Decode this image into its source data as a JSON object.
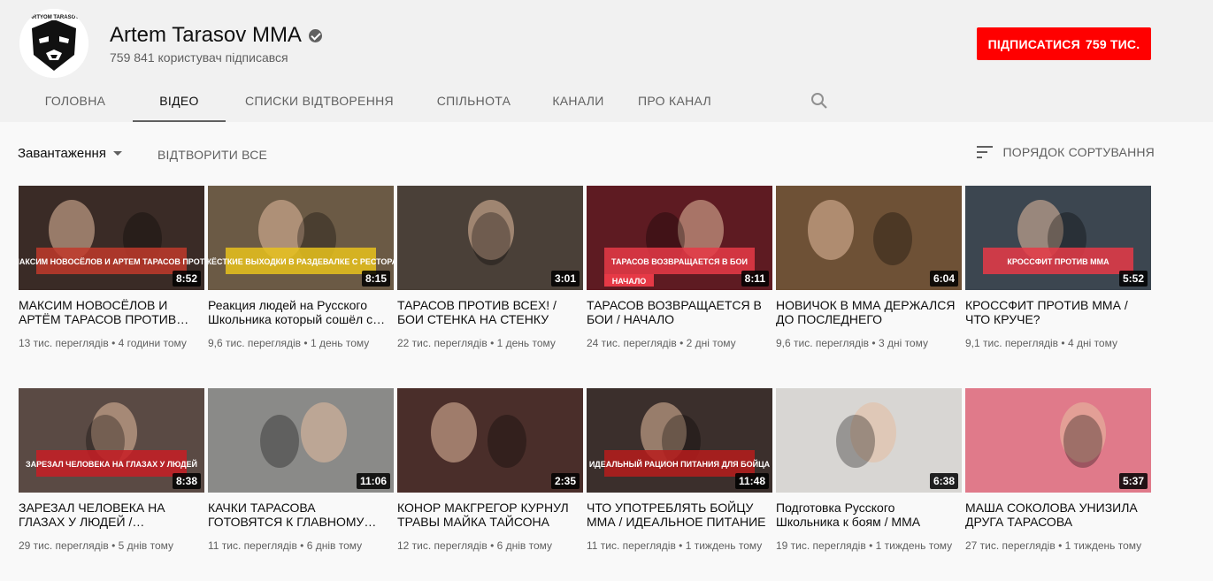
{
  "channel": {
    "name": "Artem Tarasov MMA",
    "subscribers": "759 841 користувач підписався",
    "logo_text": "ARTYOM TARASOV",
    "subscribe_label": "ПІДПИСАТИСЯ",
    "subscribe_count": "759 ТИС."
  },
  "tabs": [
    {
      "label": "ГОЛОВНА",
      "active": false
    },
    {
      "label": "ВІДЕО",
      "active": true
    },
    {
      "label": "СПИСКИ ВІДТВОРЕННЯ",
      "active": false
    },
    {
      "label": "СПІЛЬНОТА",
      "active": false
    },
    {
      "label": "КАНАЛИ",
      "active": false
    },
    {
      "label": "ПРО КАНАЛ",
      "active": false
    }
  ],
  "controls": {
    "uploads_label": "Завантаження",
    "play_all_label": "ВІДТВОРИТИ ВСЕ",
    "sort_label": "ПОРЯДОК СОРТУВАННЯ"
  },
  "colors": {
    "accent": "#ff0000",
    "text_secondary": "#606060",
    "header_bg": "#f1f1f1",
    "page_bg": "#f9f9f9"
  },
  "videos": [
    {
      "title": "МАКСИМ НОВОСЁЛОВ И АРТЁМ ТАРАСОВ ПРОТИВ ТРОИХ ПИТБУЛЕЙ",
      "views": "13 тис. переглядів",
      "age": "4 години тому",
      "duration": "8:52",
      "thumb_text": "МАКСИМ НОВОСЁЛОВ И АРТЕМ ТАРАСОВ ПРОТИВ ТРОИХ ПИТБУЛЕЙ",
      "bg": "#3a2b26",
      "accent": "#c0392b"
    },
    {
      "title": "Реакция людей на Русского Школьника который сошёл с ума",
      "views": "9,6 тис. переглядів",
      "age": "1 день тому",
      "duration": "8:15",
      "thumb_text": "ЖЁСТКИЕ ВЫХОДКИ В РАЗДЕВАЛКЕ С РЕСТОРАТОРОМ",
      "bg": "#6b5a45",
      "accent": "#e8c21c"
    },
    {
      "title": "ТАРАСОВ ПРОТИВ ВСЕХ! / БОИ СТЕНКА НА СТЕНКУ",
      "views": "22 тис. переглядів",
      "age": "1 день тому",
      "duration": "3:01",
      "thumb_text": "",
      "bg": "#4a4038",
      "accent": "#d62828"
    },
    {
      "title": "ТАРАСОВ ВОЗВРАЩАЕТСЯ В БОИ / НАЧАЛО",
      "views": "24 тис. переглядів",
      "age": "2 дні тому",
      "duration": "8:11",
      "thumb_text": "ТАРАСОВ ВОЗВРАЩАЕТСЯ В БОИ",
      "thumb_badge": "НАЧАЛО",
      "bg": "#5e1b22",
      "accent": "#e63946"
    },
    {
      "title": "НОВИЧОК В ММА ДЕРЖАЛСЯ ДО ПОСЛЕДНЕГО",
      "views": "9,6 тис. переглядів",
      "age": "3 дні тому",
      "duration": "6:04",
      "thumb_text": "",
      "bg": "#6e5136",
      "accent": "#b8432c"
    },
    {
      "title": "КРОССФИТ ПРОТИВ ММА / ЧТО КРУЧЕ?",
      "views": "9,1 тис. переглядів",
      "age": "4 дні тому",
      "duration": "5:52",
      "thumb_text": "КРОССФИТ ПРОТИВ ММА",
      "bg": "#3c4650",
      "accent": "#e63946"
    },
    {
      "title": "ЗАРЕЗАЛ ЧЕЛОВЕКА НА ГЛАЗАХ У ЛЮДЕЙ / СОЦИАЛЬНЫЙ ЭКСПЕРИМЕНТ",
      "views": "29 тис. переглядів",
      "age": "5 днів тому",
      "duration": "8:38",
      "thumb_text": "ЗАРЕЗАЛ ЧЕЛОВЕКА НА ГЛАЗАХ У ЛЮДЕЙ",
      "bg": "#5a4a44",
      "accent": "#c81d25"
    },
    {
      "title": "КАЧКИ ТАРАСОВА ГОТОВЯТСЯ К ГЛАВНОМУ ТУРНИРУ",
      "views": "11 тис. переглядів",
      "age": "6 днів тому",
      "duration": "11:06",
      "thumb_text": "",
      "bg": "#8a8a88",
      "accent": "#c62828"
    },
    {
      "title": "КОНОР МАКГРЕГОР КУРНУЛ ТРАВЫ МАЙКА ТАЙСОНА",
      "views": "12 тис. переглядів",
      "age": "6 днів тому",
      "duration": "2:35",
      "thumb_text": "",
      "bg": "#4a2e2a",
      "accent": "#e53935"
    },
    {
      "title": "ЧТО УПОТРЕБЛЯТЬ БОЙЦУ ММА / ИДЕАЛЬНОЕ ПИТАНИЕ",
      "views": "11 тис. переглядів",
      "age": "1 тиждень тому",
      "duration": "11:48",
      "thumb_text": "ИДЕАЛЬНЫЙ РАЦИОН ПИТАНИЯ ДЛЯ БОЙЦА",
      "bg": "#3b2f2c",
      "accent": "#b71c1c"
    },
    {
      "title": "Подготовка Русского Школьника к боям / ММА",
      "views": "19 тис. переглядів",
      "age": "1 тиждень тому",
      "duration": "6:38",
      "thumb_text": "",
      "bg": "#d8d6d3",
      "accent": "#222222"
    },
    {
      "title": "МАША СОКОЛОВА УНИЗИЛА ДРУГА ТАРАСОВА",
      "views": "27 тис. переглядів",
      "age": "1 тиждень тому",
      "duration": "5:37",
      "thumb_text": "",
      "bg": "#e07a8a",
      "accent": "#b8123a"
    }
  ]
}
